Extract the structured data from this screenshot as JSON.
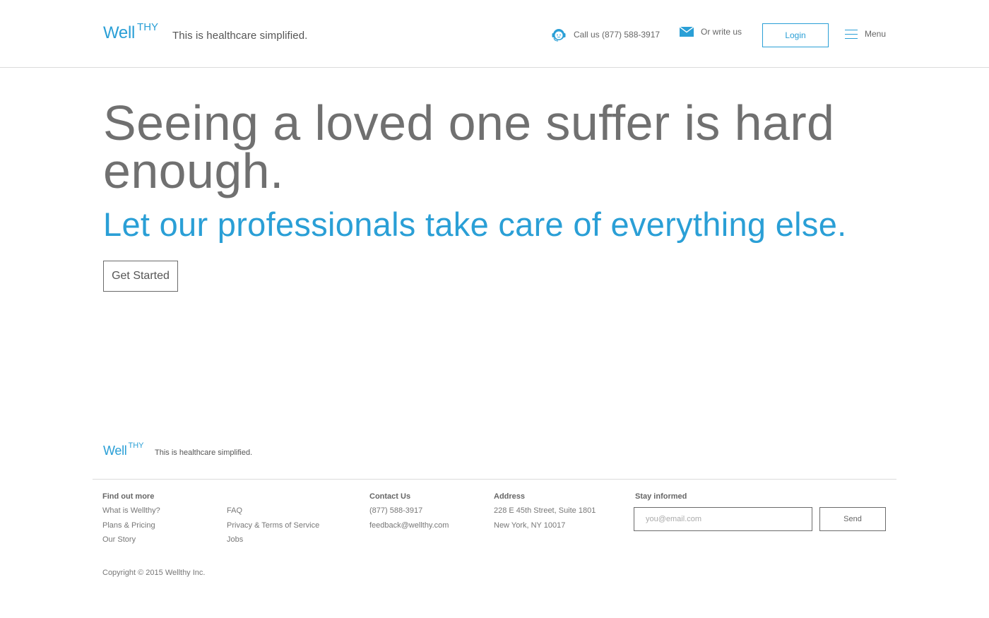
{
  "header": {
    "logo_main": "Well",
    "logo_super": "THY",
    "tagline": "This is healthcare simplified.",
    "call_label": "Call us (877) 588-3917",
    "write_label": "Or write us",
    "login_label": "Login",
    "menu_label": "Menu"
  },
  "hero": {
    "title": "Seeing a loved one suffer is hard enough.",
    "subtitle": "Let our professionals take care of everything else.",
    "cta_label": "Get Started"
  },
  "footer": {
    "logo_main": "Well",
    "logo_super": "THY",
    "tagline": "This is healthcare simplified.",
    "find_out_more": {
      "heading": "Find out more",
      "links_a": [
        "What is Wellthy?",
        "Plans & Pricing",
        "Our Story"
      ],
      "links_b": [
        "FAQ",
        "Privacy & Terms of Service",
        "Jobs"
      ]
    },
    "contact": {
      "heading": "Contact Us",
      "phone": "(877) 588-3917",
      "email": "feedback@wellthy.com"
    },
    "address": {
      "heading": "Address",
      "line1": "228 E 45th Street, Suite 1801",
      "line2": "New York, NY 10017"
    },
    "newsletter": {
      "heading": "Stay informed",
      "placeholder": "you@email.com",
      "send_label": "Send"
    },
    "copyright": "Copyright © 2015 Wellthy  Inc."
  },
  "colors": {
    "accent": "#2a9fd6",
    "text": "#707070",
    "border": "#dcdcdc"
  },
  "icons": {
    "call": "support-agent-icon",
    "write": "envelope-icon",
    "menu": "hamburger-menu-icon"
  }
}
